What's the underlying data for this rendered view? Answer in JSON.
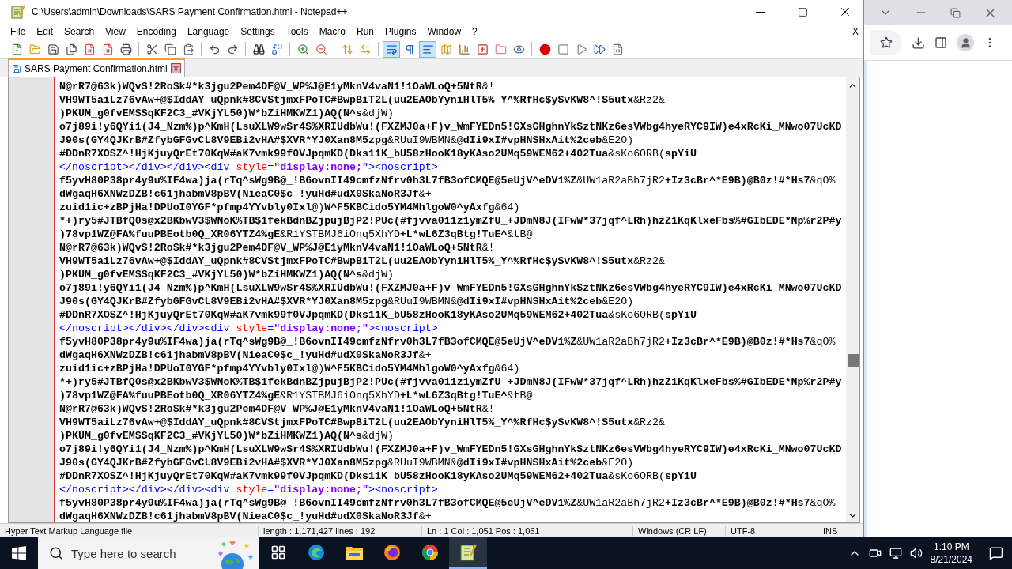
{
  "window": {
    "title": "C:\\Users\\admin\\Downloads\\SARS Payment Confirmation.html - Notepad++",
    "close_doc": "X"
  },
  "menu": [
    "File",
    "Edit",
    "Search",
    "View",
    "Encoding",
    "Language",
    "Settings",
    "Tools",
    "Macro",
    "Run",
    "Plugins",
    "Window",
    "?"
  ],
  "toolbar": [
    {
      "kind": "new",
      "selected": false
    },
    {
      "kind": "open",
      "selected": false
    },
    {
      "kind": "save",
      "selected": false
    },
    {
      "kind": "save-all",
      "selected": false
    },
    {
      "kind": "close",
      "selected": false
    },
    {
      "kind": "close-all",
      "selected": false
    },
    {
      "kind": "print",
      "selected": false
    },
    {
      "kind": "sep"
    },
    {
      "kind": "cut",
      "selected": false
    },
    {
      "kind": "copy",
      "selected": false
    },
    {
      "kind": "paste",
      "selected": false
    },
    {
      "kind": "sep"
    },
    {
      "kind": "undo",
      "selected": false
    },
    {
      "kind": "redo",
      "selected": false
    },
    {
      "kind": "sep"
    },
    {
      "kind": "find",
      "selected": false
    },
    {
      "kind": "replace",
      "selected": false
    },
    {
      "kind": "sep"
    },
    {
      "kind": "zoom-in",
      "selected": false
    },
    {
      "kind": "zoom-out",
      "selected": false
    },
    {
      "kind": "sep"
    },
    {
      "kind": "sync-v",
      "selected": false
    },
    {
      "kind": "sync-h",
      "selected": false
    },
    {
      "kind": "sep"
    },
    {
      "kind": "wrap",
      "selected": true
    },
    {
      "kind": "pilcrow",
      "selected": false
    },
    {
      "kind": "indent",
      "selected": true
    },
    {
      "kind": "doc-map",
      "selected": false
    },
    {
      "kind": "chart",
      "selected": false
    },
    {
      "kind": "function",
      "selected": false
    },
    {
      "kind": "folder",
      "selected": false
    },
    {
      "kind": "eye",
      "selected": false
    },
    {
      "kind": "sep"
    },
    {
      "kind": "record",
      "selected": false
    },
    {
      "kind": "stop",
      "selected": false
    },
    {
      "kind": "play",
      "selected": false
    },
    {
      "kind": "play-multi",
      "selected": false
    },
    {
      "kind": "save-macro",
      "selected": false
    }
  ],
  "tab": {
    "label": "SARS Payment Confirmation.html",
    "selected": true
  },
  "editor_lines": [
    [
      {
        "kind": "bold",
        "text": "N@rR7@63k)WQvS!2Ro$k#*k3jgu2Pem4DF@V_WP%J@E1yMknV4vaN1!1OaWLoQ+5NtR"
      },
      {
        "kind": "plain",
        "text": "&!"
      }
    ],
    [
      {
        "kind": "bold",
        "text": "VH9WT5aiLz76vAw+@$IddAY_uQpnk#8CVStjmxFPoTC#BwpBiT2L(uu2EAObYyniHlT5%_Y^%RfHc$ySvKW8^!S5utx"
      },
      {
        "kind": "plain",
        "text": "&Rz2&"
      }
    ],
    [
      {
        "kind": "bold",
        "text": ")PKUM_g0fvEM$SqKF2C3_#VKjYL50)W*bZiHMKWZ1)AQ(N^s"
      },
      {
        "kind": "plain",
        "text": "&djW)"
      }
    ],
    [
      {
        "kind": "bold",
        "text": "o7j89i!y6QYi1(J4_Nzm%)p^KmH(LsuXLW9wSr4S%XRIUdbWu!(FXZMJ0a+F)v_WmFYEDn5!GXsGHghnYkSztNKz6esVWbg4hyeRYC9IW)e4xRcKi_MNwo07UcKD"
      }
    ],
    [
      {
        "kind": "bold",
        "text": "J90s(GY4QJKrB#ZfybGFGvCL8V9EBi2vHA#$XVR*YJ0Xan8M5zpg"
      },
      {
        "kind": "plain",
        "text": "&RUuI9WBMN&"
      },
      {
        "kind": "bold",
        "text": "@dIi9xI#vpHNSHxAit%2ceb"
      },
      {
        "kind": "plain",
        "text": "&E2O)"
      }
    ],
    [
      {
        "kind": "bold",
        "text": "#DDnR7XOSZ^!HjKjuyQrEt70KqW#aK7vmk99f0VJpqmKD(Dks11K_bU58zHooK18yKAso2UMq59WEM62+402Tua"
      },
      {
        "kind": "plain",
        "text": "&sKo6ORB("
      },
      {
        "kind": "bold",
        "text": "spYiU"
      }
    ],
    [
      {
        "kind": "tag",
        "text": "</noscript></div></div><div "
      },
      {
        "kind": "attr",
        "text": "style"
      },
      {
        "kind": "tag",
        "text": "="
      },
      {
        "kind": "value",
        "text": "\"display:none;\""
      },
      {
        "kind": "tag",
        "text": "><noscript>"
      }
    ],
    [
      {
        "kind": "bold",
        "text": "f5yvH80P38pr4y9u%IF4wa)ja(rTq^sWg9B@_!B6ovnII49cmfzNfrv0h3L7fB3ofCMQE@5eUjV^eDV1%Z"
      },
      {
        "kind": "plain",
        "text": "&UW1aR2aBh7jR2"
      },
      {
        "kind": "bold",
        "text": "+Iz3cBr^*E9B)@B0z!#*Hs7"
      },
      {
        "kind": "plain",
        "text": "&qO%"
      }
    ],
    [
      {
        "kind": "bold",
        "text": "dWgaqH6XNWzDZB!c61jhabmV8pBV(NieaC0$c_!yuHd#udX0SkaNoR3Jf"
      },
      {
        "kind": "plain",
        "text": "&+"
      }
    ],
    [
      {
        "kind": "bold",
        "text": "zuid1ic+zBPjHa!DPUoI0YGF*pfmp4YYvbly0Ixl"
      },
      {
        "kind": "plain",
        "text": "@)"
      },
      {
        "kind": "bold",
        "text": "W^F5KBCido5YM4MhlgoW0^yAxfg"
      },
      {
        "kind": "plain",
        "text": "&64)"
      }
    ],
    [
      {
        "kind": "bold",
        "text": "*+)ry5#JTBfQ0s@x2BKbwV3$WNoK%TB$1fekBdnBZjpujBjP2!PUc(#fjvva011z1ymZfU_+JDmN8J(IFwW*37jqf^LRh)hzZ1KqKlxeFbs%#GIbEDE*Np%r2P#y"
      }
    ],
    [
      {
        "kind": "bold",
        "text": ")78vp1WZ@FA%fuuPBEotb0Q_XR06YTZ4%gE"
      },
      {
        "kind": "plain",
        "text": "&R1YSTBMJ6iOnq5XhYD"
      },
      {
        "kind": "bold",
        "text": "+L*wL6Z3qBtg!TuE^"
      },
      {
        "kind": "plain",
        "text": "&tB@"
      }
    ],
    [
      {
        "kind": "bold",
        "text": "N@rR7@63k)WQvS!2Ro$k#*k3jgu2Pem4DF@V_WP%J@E1yMknV4vaN1!1OaWLoQ+5NtR"
      },
      {
        "kind": "plain",
        "text": "&!"
      }
    ],
    [
      {
        "kind": "bold",
        "text": "VH9WT5aiLz76vAw+@$IddAY_uQpnk#8CVStjmxFPoTC#BwpBiT2L(uu2EAObYyniHlT5%_Y^%RfHc$ySvKW8^!S5utx"
      },
      {
        "kind": "plain",
        "text": "&Rz2&"
      }
    ],
    [
      {
        "kind": "bold",
        "text": ")PKUM_g0fvEM$SqKF2C3_#VKjYL50)W*bZiHMKWZ1)AQ(N^s"
      },
      {
        "kind": "plain",
        "text": "&djW)"
      }
    ],
    [
      {
        "kind": "bold",
        "text": "o7j89i!y6QYi1(J4_Nzm%)p^KmH(LsuXLW9wSr4S%XRIUdbWu!(FXZMJ0a+F)v_WmFYEDn5!GXsGHghnYkSztNKz6esVWbg4hyeRYC9IW)e4xRcKi_MNwo07UcKD"
      }
    ],
    [
      {
        "kind": "bold",
        "text": "J90s(GY4QJKrB#ZfybGFGvCL8V9EBi2vHA#$XVR*YJ0Xan8M5zpg"
      },
      {
        "kind": "plain",
        "text": "&RUuI9WBMN&"
      },
      {
        "kind": "bold",
        "text": "@dIi9xI#vpHNSHxAit%2ceb"
      },
      {
        "kind": "plain",
        "text": "&E2O)"
      }
    ],
    [
      {
        "kind": "bold",
        "text": "#DDnR7XOSZ^!HjKjuyQrEt70KqW#aK7vmk99f0VJpqmKD(Dks11K_bU58zHooK18yKAso2UMq59WEM62+402Tua"
      },
      {
        "kind": "plain",
        "text": "&sKo6ORB("
      },
      {
        "kind": "bold",
        "text": "spYiU"
      }
    ],
    [
      {
        "kind": "tag",
        "text": "</noscript></div></div><div "
      },
      {
        "kind": "attr",
        "text": "style"
      },
      {
        "kind": "tag",
        "text": "="
      },
      {
        "kind": "value",
        "text": "\"display:none;\""
      },
      {
        "kind": "tag",
        "text": "><noscript>"
      }
    ],
    [
      {
        "kind": "bold",
        "text": "f5yvH80P38pr4y9u%IF4wa)ja(rTq^sWg9B@_!B6ovnII49cmfzNfrv0h3L7fB3ofCMQE@5eUjV^eDV1%Z"
      },
      {
        "kind": "plain",
        "text": "&UW1aR2aBh7jR2"
      },
      {
        "kind": "bold",
        "text": "+Iz3cBr^*E9B)@B0z!#*Hs7"
      },
      {
        "kind": "plain",
        "text": "&qO%"
      }
    ],
    [
      {
        "kind": "bold",
        "text": "dWgaqH6XNWzDZB!c61jhabmV8pBV(NieaC0$c_!yuHd#udX0SkaNoR3Jf"
      },
      {
        "kind": "plain",
        "text": "&+"
      }
    ],
    [
      {
        "kind": "bold",
        "text": "zuid1ic+zBPjHa!DPUoI0YGF*pfmp4YYvbly0Ixl"
      },
      {
        "kind": "plain",
        "text": "@)"
      },
      {
        "kind": "bold",
        "text": "W^F5KBCido5YM4MhlgoW0^yAxfg"
      },
      {
        "kind": "plain",
        "text": "&64)"
      }
    ],
    [
      {
        "kind": "bold",
        "text": "*+)ry5#JTBfQ0s@x2BKbwV3$WNoK%TB$1fekBdnBZjpujBjP2!PUc(#fjvva011z1ymZfU_+JDmN8J(IFwW*37jqf^LRh)hzZ1KqKlxeFbs%#GIbEDE*Np%r2P#y"
      }
    ],
    [
      {
        "kind": "bold",
        "text": ")78vp1WZ@FA%fuuPBEotb0Q_XR06YTZ4%gE"
      },
      {
        "kind": "plain",
        "text": "&R1YSTBMJ6iOnq5XhYD"
      },
      {
        "kind": "bold",
        "text": "+L*wL6Z3qBtg!TuE^"
      },
      {
        "kind": "plain",
        "text": "&tB@"
      }
    ],
    [
      {
        "kind": "bold",
        "text": "N@rR7@63k)WQvS!2Ro$k#*k3jgu2Pem4DF@V_WP%J@E1yMknV4vaN1!1OaWLoQ+5NtR"
      },
      {
        "kind": "plain",
        "text": "&!"
      }
    ],
    [
      {
        "kind": "bold",
        "text": "VH9WT5aiLz76vAw+@$IddAY_uQpnk#8CVStjmxFPoTC#BwpBiT2L(uu2EAObYyniHlT5%_Y^%RfHc$ySvKW8^!S5utx"
      },
      {
        "kind": "plain",
        "text": "&Rz2&"
      }
    ],
    [
      {
        "kind": "bold",
        "text": ")PKUM_g0fvEM$SqKF2C3_#VKjYL50)W*bZiHMKWZ1)AQ(N^s"
      },
      {
        "kind": "plain",
        "text": "&djW)"
      }
    ],
    [
      {
        "kind": "bold",
        "text": "o7j89i!y6QYi1(J4_Nzm%)p^KmH(LsuXLW9wSr4S%XRIUdbWu!(FXZMJ0a+F)v_WmFYEDn5!GXsGHghnYkSztNKz6esVWbg4hyeRYC9IW)e4xRcKi_MNwo07UcKD"
      }
    ],
    [
      {
        "kind": "bold",
        "text": "J90s(GY4QJKrB#ZfybGFGvCL8V9EBi2vHA#$XVR*YJ0Xan8M5zpg"
      },
      {
        "kind": "plain",
        "text": "&RUuI9WBMN&"
      },
      {
        "kind": "bold",
        "text": "@dIi9xI#vpHNSHxAit%2ceb"
      },
      {
        "kind": "plain",
        "text": "&E2O)"
      }
    ],
    [
      {
        "kind": "bold",
        "text": "#DDnR7XOSZ^!HjKjuyQrEt70KqW#aK7vmk99f0VJpqmKD(Dks11K_bU58zHooK18yKAso2UMq59WEM62+402Tua"
      },
      {
        "kind": "plain",
        "text": "&sKo6ORB("
      },
      {
        "kind": "bold",
        "text": "spYiU"
      }
    ],
    [
      {
        "kind": "tag",
        "text": "</noscript></div></div><div "
      },
      {
        "kind": "attr",
        "text": "style"
      },
      {
        "kind": "tag",
        "text": "="
      },
      {
        "kind": "value",
        "text": "\"display:none;\""
      },
      {
        "kind": "tag",
        "text": "><noscript>"
      }
    ],
    [
      {
        "kind": "bold",
        "text": "f5yvH80P38pr4y9u%IF4wa)ja(rTq^sWg9B@_!B6ovnII49cmfzNfrv0h3L7fB3ofCMQE@5eUjV^eDV1%Z"
      },
      {
        "kind": "plain",
        "text": "&UW1aR2aBh7jR2"
      },
      {
        "kind": "bold",
        "text": "+Iz3cBr^*E9B)@B0z!#*Hs7"
      },
      {
        "kind": "plain",
        "text": "&qO%"
      }
    ],
    [
      {
        "kind": "bold",
        "text": "dWgaqH6XNWzDZB!c61jhabmV8pBV(NieaC0$c_!yuHd#udX0SkaNoR3Jf"
      },
      {
        "kind": "plain",
        "text": "&+"
      }
    ]
  ],
  "status_bar": [
    "Hyper Text Markup Language file",
    "length : 1,171,427    lines : 192",
    "Ln : 1    Col : 1,051    Pos : 1,051",
    "Windows (CR LF)",
    "UTF-8",
    "INS"
  ],
  "taskbar": {
    "search_placeholder": "Type here to search",
    "apps": [
      {
        "kind": "taskview",
        "selected": false
      },
      {
        "kind": "edge",
        "selected": false
      },
      {
        "kind": "explorer",
        "selected": false
      },
      {
        "kind": "firefox",
        "selected": false
      },
      {
        "kind": "chrome",
        "selected": false
      },
      {
        "kind": "notepad",
        "selected": true
      }
    ],
    "time": "1:10 PM",
    "date": "8/21/2024"
  }
}
